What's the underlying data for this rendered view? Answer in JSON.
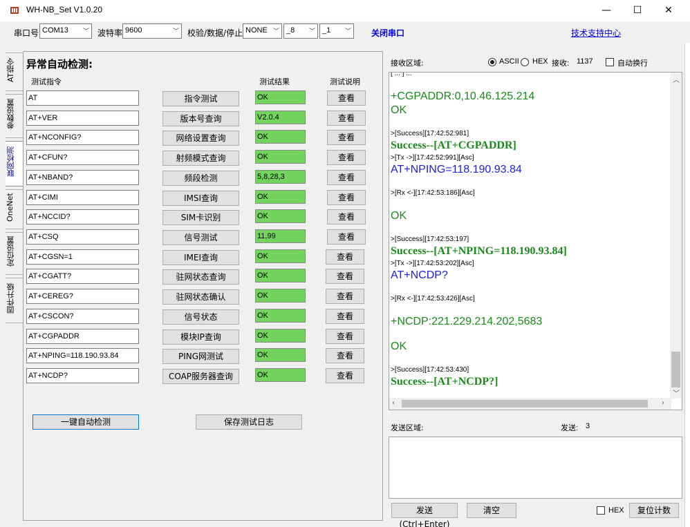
{
  "window": {
    "title": "WH-NB_Set V1.0.20",
    "min": "—",
    "max": "☐",
    "close": "✕"
  },
  "toolbar": {
    "port_label": "串口号",
    "port_value": "COM13",
    "baud_label": "波特率",
    "baud_value": "9600",
    "parity_label": "校验/数据/停止",
    "parity_value": "NONE",
    "data_value": "_8",
    "stop_value": "_1",
    "close_port": "关闭串口",
    "support": "技术支持中心"
  },
  "tabs": [
    "AT指令",
    "参数设置",
    "联网检测",
    "OneNet",
    "定位设置",
    "固件升级"
  ],
  "panel": {
    "title": "异常自动检测:",
    "col_cmd": "测试指令",
    "col_result": "测试结果",
    "col_desc": "测试说明",
    "rows": [
      {
        "cmd": "AT",
        "btn": "指令测试",
        "result": "OK",
        "view": "查看"
      },
      {
        "cmd": "AT+VER",
        "btn": "版本号查询",
        "result": "V2.0.4",
        "view": "查看"
      },
      {
        "cmd": "AT+NCONFIG?",
        "btn": "网络设置查询",
        "result": "OK",
        "view": "查看"
      },
      {
        "cmd": "AT+CFUN?",
        "btn": "射频模式查询",
        "result": "OK",
        "view": "查看"
      },
      {
        "cmd": "AT+NBAND?",
        "btn": "频段检测",
        "result": "5,8,28,3",
        "view": "查看"
      },
      {
        "cmd": "AT+CIMI",
        "btn": "IMSI查询",
        "result": "OK",
        "view": "查看"
      },
      {
        "cmd": "AT+NCCID?",
        "btn": "SIM卡识别",
        "result": "OK",
        "view": "查看"
      },
      {
        "cmd": "AT+CSQ",
        "btn": "信号测试",
        "result": "11,99",
        "view": "查看"
      },
      {
        "cmd": "AT+CGSN=1",
        "btn": "IMEI查询",
        "result": "OK",
        "view": "查看"
      },
      {
        "cmd": "AT+CGATT?",
        "btn": "驻网状态查询",
        "result": "OK",
        "view": "查看"
      },
      {
        "cmd": "AT+CEREG?",
        "btn": "驻网状态确认",
        "result": "OK",
        "view": "查看"
      },
      {
        "cmd": "AT+CSCON?",
        "btn": "信号状态",
        "result": "OK",
        "view": "查看"
      },
      {
        "cmd": "AT+CGPADDR",
        "btn": "模块IP查询",
        "result": "OK",
        "view": "查看"
      },
      {
        "cmd": "AT+NPING=118.190.93.84",
        "btn": "PING网测试",
        "result": "OK",
        "view": "查看"
      },
      {
        "cmd": "AT+NCDP?",
        "btn": "COAP服务器查询",
        "result": "OK",
        "view": "查看"
      }
    ],
    "auto_btn": "一键自动检测",
    "save_btn": "保存测试日志"
  },
  "recv": {
    "label": "接收区域:",
    "ascii": "ASCII",
    "hex": "HEX",
    "count_label": "接收:",
    "count": "1137",
    "autowrap": "自动换行",
    "lines": [
      {
        "k": "meta",
        "t": "[ ...    ] ..."
      },
      {
        "k": "gap",
        "t": ""
      },
      {
        "k": "rx",
        "t": "+CGPADDR:0,10.46.125.214"
      },
      {
        "k": "rx",
        "t": "OK"
      },
      {
        "k": "gap",
        "t": ""
      },
      {
        "k": "meta",
        "t": ">[Success][17:42:52:981]"
      },
      {
        "k": "ok",
        "t": "Success--[AT+CGPADDR]"
      },
      {
        "k": "meta",
        "t": ">[Tx ->][17:42:52:991][Asc]"
      },
      {
        "k": "tx",
        "t": "AT+NPING=118.190.93.84"
      },
      {
        "k": "gap",
        "t": ""
      },
      {
        "k": "meta",
        "t": ">[Rx <-][17:42:53:186][Asc]"
      },
      {
        "k": "gap",
        "t": ""
      },
      {
        "k": "rx",
        "t": "OK"
      },
      {
        "k": "gap",
        "t": ""
      },
      {
        "k": "meta",
        "t": ">[Success][17:42:53:197]"
      },
      {
        "k": "ok",
        "t": "Success--[AT+NPING=118.190.93.84]"
      },
      {
        "k": "meta",
        "t": ">[Tx ->][17:42:53:202][Asc]"
      },
      {
        "k": "tx",
        "t": "AT+NCDP?"
      },
      {
        "k": "gap",
        "t": ""
      },
      {
        "k": "meta",
        "t": ">[Rx <-][17:42:53:426][Asc]"
      },
      {
        "k": "gap",
        "t": ""
      },
      {
        "k": "rx",
        "t": "+NCDP:221.229.214.202,5683"
      },
      {
        "k": "gap",
        "t": ""
      },
      {
        "k": "rx",
        "t": "OK"
      },
      {
        "k": "gap",
        "t": ""
      },
      {
        "k": "meta",
        "t": ">[Success][17:42:53:430]"
      },
      {
        "k": "ok",
        "t": "Success--[AT+NCDP?]"
      }
    ]
  },
  "send": {
    "label": "发送区域:",
    "count_label": "发送:",
    "count": "3",
    "send_btn": "发送(Ctrl+Enter)",
    "clear_btn": "清空",
    "hex": "HEX",
    "reset_btn": "复位计数"
  }
}
